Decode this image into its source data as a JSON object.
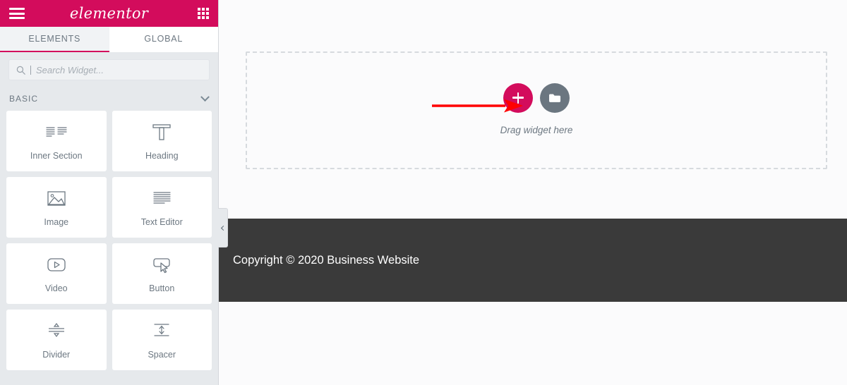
{
  "panel": {
    "header": {
      "menu_icon": "hamburger-icon",
      "brand": "elementor",
      "apps_icon": "grid-apps-icon"
    },
    "tabs": [
      {
        "label": "ELEMENTS",
        "active": true
      },
      {
        "label": "GLOBAL",
        "active": false
      }
    ],
    "search": {
      "icon": "search-icon",
      "placeholder": "Search Widget...",
      "value": ""
    },
    "section": {
      "title": "BASIC",
      "toggle_icon": "chevron-down-icon"
    },
    "widgets": [
      {
        "label": "Inner Section",
        "icon": "inner-section-icon"
      },
      {
        "label": "Heading",
        "icon": "heading-t-icon"
      },
      {
        "label": "Image",
        "icon": "image-icon"
      },
      {
        "label": "Text Editor",
        "icon": "text-editor-icon"
      },
      {
        "label": "Video",
        "icon": "video-play-icon"
      },
      {
        "label": "Button",
        "icon": "button-cursor-icon"
      },
      {
        "label": "Divider",
        "icon": "divider-icon"
      },
      {
        "label": "Spacer",
        "icon": "spacer-icon"
      }
    ],
    "collapse": {
      "icon": "chevron-left-icon"
    }
  },
  "canvas": {
    "dropzone": {
      "add_button_icon": "plus-icon",
      "folder_button_icon": "folder-icon",
      "hint": "Drag widget here"
    },
    "annotation": {
      "type": "red-arrow",
      "color": "#ff0000",
      "points_to": "add-section-button"
    },
    "footer": {
      "copyright": "Copyright © 2020 Business Website"
    }
  },
  "colors": {
    "brand": "#d30c5c",
    "panel_bg": "#e6e9ec",
    "canvas_bg": "#fbfbfc",
    "footer_bg": "#3a3a3a",
    "text": "#6d7882",
    "folder_button": "#6b7680",
    "annotation": "#ff0000"
  }
}
